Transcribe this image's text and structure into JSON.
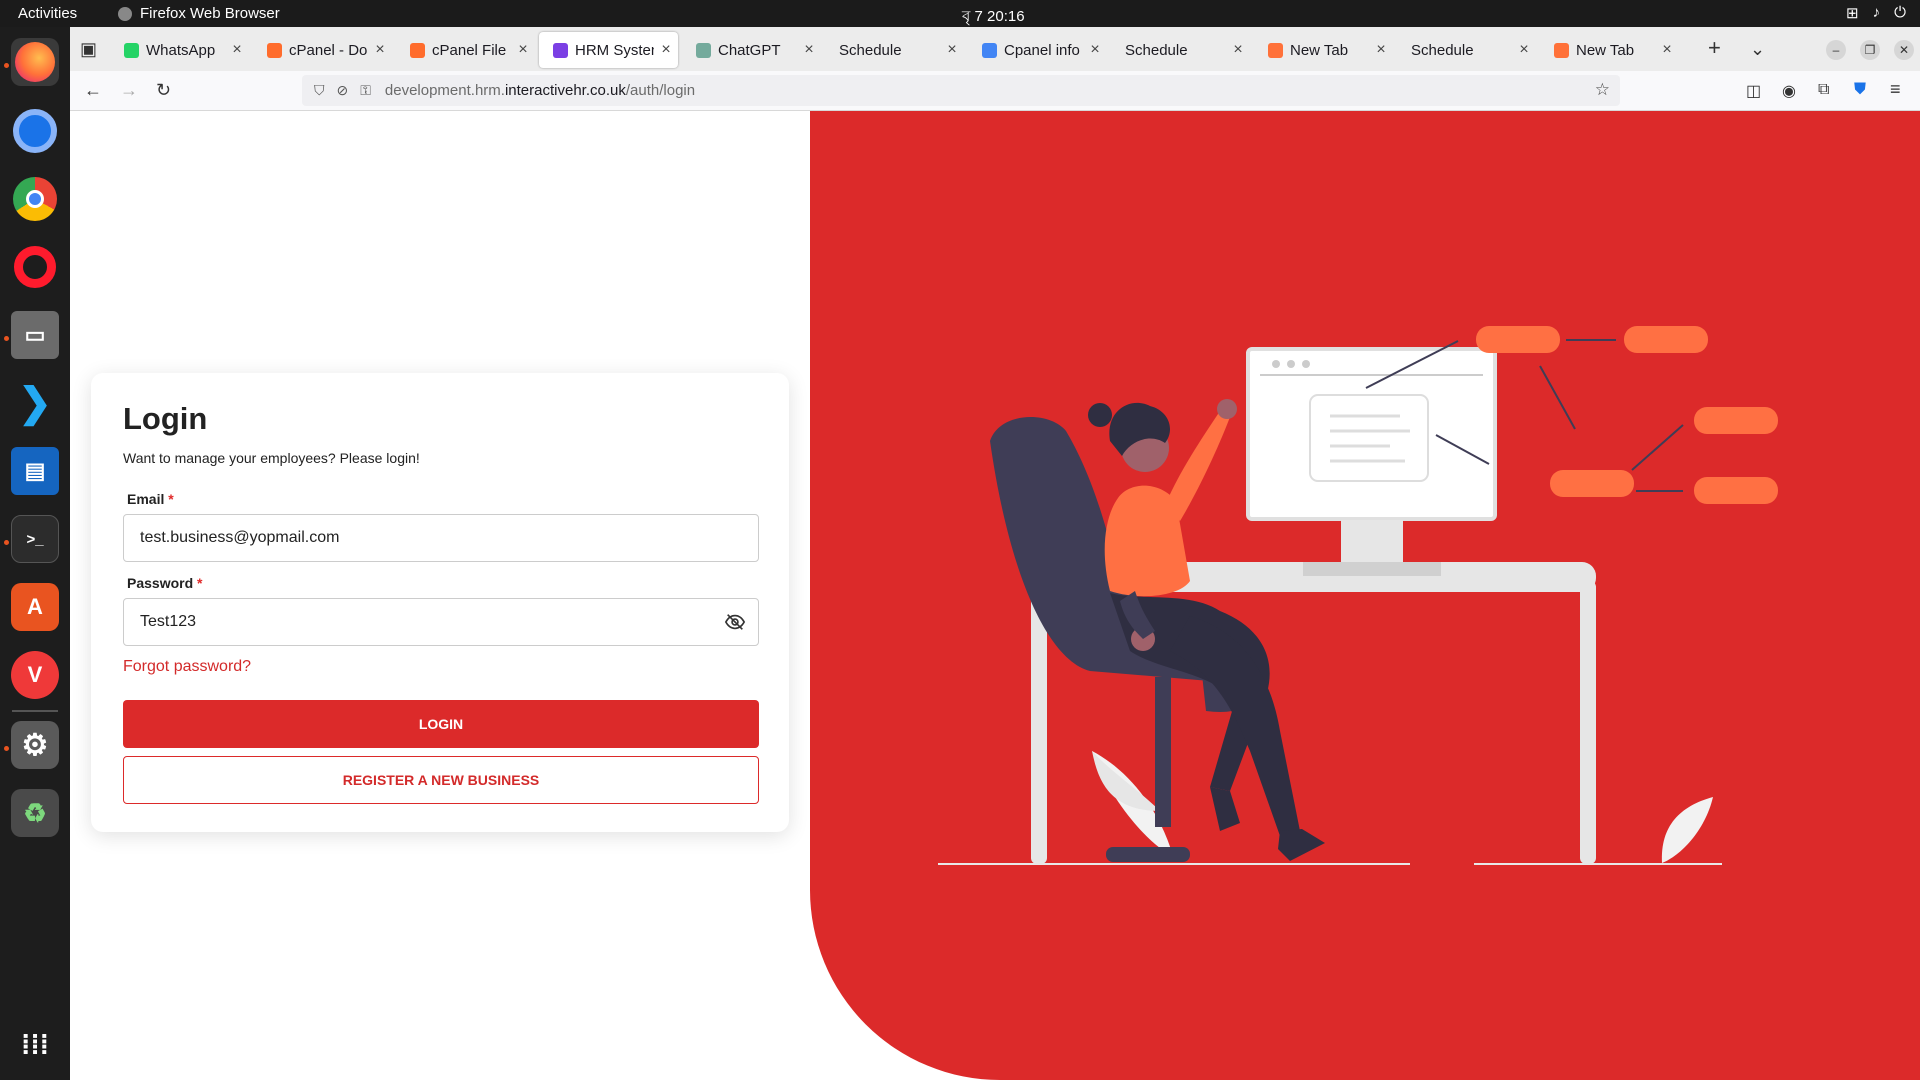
{
  "topbar": {
    "activities": "Activities",
    "app_name": "Firefox Web Browser",
    "clock": "বৃ 7  20:16"
  },
  "tabs": [
    {
      "label": "WhatsApp",
      "color": "#25d366"
    },
    {
      "label": "cPanel - Dom",
      "color": "#ff6c2c"
    },
    {
      "label": "cPanel File M",
      "color": "#ff6c2c"
    },
    {
      "label": "HRM System",
      "color": "#7b3fe4",
      "active": true
    },
    {
      "label": "ChatGPT",
      "color": "#74aa9c"
    },
    {
      "label": "Schedule",
      "color": ""
    },
    {
      "label": "Cpanel info -",
      "color": "#4285f4"
    },
    {
      "label": "Schedule",
      "color": ""
    },
    {
      "label": "New Tab",
      "color": "#ff7139"
    },
    {
      "label": "Schedule",
      "color": ""
    },
    {
      "label": "New Tab",
      "color": "#ff7139"
    }
  ],
  "url": {
    "prefix": "development.hrm.",
    "domain": "interactivehr.co.uk",
    "path": "/auth/login"
  },
  "login": {
    "title": "Login",
    "subtitle": "Want to manage your employees? Please login!",
    "email_label": "Email",
    "email_value": "test.business@yopmail.com",
    "password_label": "Password",
    "password_value": "Test123",
    "required_mark": "*",
    "forgot": "Forgot password?",
    "login_button": "LOGIN",
    "register_button": "REGISTER A NEW BUSINESS"
  },
  "colors": {
    "brand_red": "#dc2a2a",
    "accent_orange": "#ff7043"
  }
}
